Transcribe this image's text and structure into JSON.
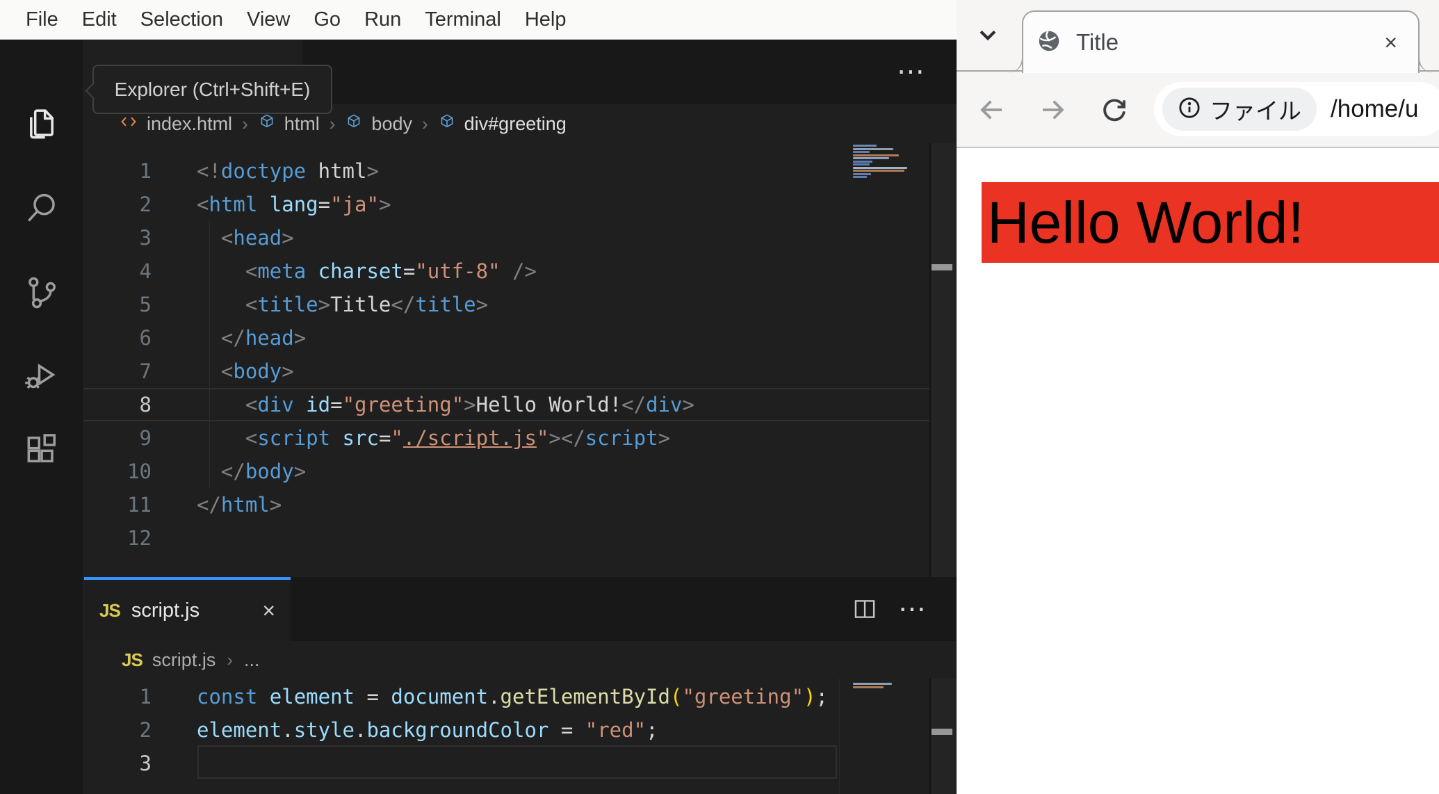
{
  "vscode": {
    "menubar": {
      "items": [
        "File",
        "Edit",
        "Selection",
        "View",
        "Go",
        "Run",
        "Terminal",
        "Help"
      ]
    },
    "activity_bar": {
      "tooltip": "Explorer (Ctrl+Shift+E)",
      "items": [
        {
          "id": "explorer",
          "icon": "files-icon",
          "active": true
        },
        {
          "id": "search",
          "icon": "search-icon",
          "active": false
        },
        {
          "id": "source-control",
          "icon": "source-control-icon",
          "active": false
        },
        {
          "id": "run-debug",
          "icon": "debug-icon",
          "active": false
        },
        {
          "id": "extensions",
          "icon": "extensions-icon",
          "active": false
        }
      ]
    },
    "editor_top": {
      "actions": {
        "more": "⋯"
      },
      "breadcrumb": {
        "file": "index.html",
        "sep": "›",
        "segments": [
          "html",
          "body",
          "div#greeting"
        ]
      },
      "active_line": 8,
      "lines": [
        [
          [
            "<!",
            "punct"
          ],
          [
            "doctype",
            "tag"
          ],
          [
            " html",
            "text"
          ],
          [
            ">",
            "punct"
          ]
        ],
        [
          [
            "<",
            "punct"
          ],
          [
            "html",
            "tag"
          ],
          [
            " ",
            "text"
          ],
          [
            "lang",
            "attr"
          ],
          [
            "=",
            "text"
          ],
          [
            "\"ja\"",
            "str"
          ],
          [
            ">",
            "punct"
          ]
        ],
        [
          [
            "  ",
            "text"
          ],
          [
            "<",
            "punct"
          ],
          [
            "head",
            "tag"
          ],
          [
            ">",
            "punct"
          ]
        ],
        [
          [
            "    ",
            "text"
          ],
          [
            "<",
            "punct"
          ],
          [
            "meta",
            "tag"
          ],
          [
            " ",
            "text"
          ],
          [
            "charset",
            "attr"
          ],
          [
            "=",
            "text"
          ],
          [
            "\"utf-8\"",
            "str"
          ],
          [
            " />",
            "punct"
          ]
        ],
        [
          [
            "    ",
            "text"
          ],
          [
            "<",
            "punct"
          ],
          [
            "title",
            "tag"
          ],
          [
            ">",
            "punct"
          ],
          [
            "Title",
            "text"
          ],
          [
            "</",
            "punct"
          ],
          [
            "title",
            "tag"
          ],
          [
            ">",
            "punct"
          ]
        ],
        [
          [
            "  ",
            "text"
          ],
          [
            "</",
            "punct"
          ],
          [
            "head",
            "tag"
          ],
          [
            ">",
            "punct"
          ]
        ],
        [
          [
            "  ",
            "text"
          ],
          [
            "<",
            "punct"
          ],
          [
            "body",
            "tag"
          ],
          [
            ">",
            "punct"
          ]
        ],
        [
          [
            "    ",
            "text"
          ],
          [
            "<",
            "punct"
          ],
          [
            "div",
            "tag"
          ],
          [
            " ",
            "text"
          ],
          [
            "id",
            "attr"
          ],
          [
            "=",
            "text"
          ],
          [
            "\"greeting\"",
            "str"
          ],
          [
            ">",
            "punct"
          ],
          [
            "Hello World!",
            "text"
          ],
          [
            "</",
            "punct"
          ],
          [
            "div",
            "tag"
          ],
          [
            ">",
            "punct"
          ]
        ],
        [
          [
            "    ",
            "text"
          ],
          [
            "<",
            "punct"
          ],
          [
            "script",
            "tag"
          ],
          [
            " ",
            "text"
          ],
          [
            "src",
            "attr"
          ],
          [
            "=",
            "text"
          ],
          [
            "\"",
            "str"
          ],
          [
            "./script.js",
            "strlink"
          ],
          [
            "\"",
            "str"
          ],
          [
            ">",
            "punct"
          ],
          [
            "</",
            "punct"
          ],
          [
            "script",
            "tag"
          ],
          [
            ">",
            "punct"
          ]
        ],
        [
          [
            "  ",
            "text"
          ],
          [
            "</",
            "punct"
          ],
          [
            "body",
            "tag"
          ],
          [
            ">",
            "punct"
          ]
        ],
        [
          [
            "</",
            "punct"
          ],
          [
            "html",
            "tag"
          ],
          [
            ">",
            "punct"
          ]
        ],
        []
      ],
      "minimap": [
        [
          34,
          "#6d88b3"
        ],
        [
          58,
          "#8f9db0"
        ],
        [
          24,
          "#5f7fb0"
        ],
        [
          66,
          "#b07a55"
        ],
        [
          52,
          "#8aa2c0"
        ],
        [
          28,
          "#5f7fb0"
        ],
        [
          24,
          "#5f7fb0"
        ],
        [
          78,
          "#a0b2c8"
        ],
        [
          74,
          "#b07a55"
        ],
        [
          26,
          "#5f7fb0"
        ],
        [
          20,
          "#5f7fb0"
        ]
      ]
    },
    "editor_bottom": {
      "tab": {
        "icon": "JS",
        "label": "script.js",
        "close": "×"
      },
      "actions": {
        "more": "⋯"
      },
      "breadcrumb": {
        "icon": "JS",
        "file": "script.js",
        "sep": "›",
        "more": "..."
      },
      "active_line": 3,
      "lines": [
        [
          [
            "const",
            "kw"
          ],
          [
            " ",
            "text"
          ],
          [
            "element",
            "var"
          ],
          [
            " = ",
            "text"
          ],
          [
            "document",
            "var"
          ],
          [
            ".",
            "text"
          ],
          [
            "getElementById",
            "fn"
          ],
          [
            "(",
            "paren"
          ],
          [
            "\"greeting\"",
            "str"
          ],
          [
            ")",
            "paren"
          ],
          [
            ";",
            "text"
          ]
        ],
        [
          [
            "element",
            "var"
          ],
          [
            ".",
            "text"
          ],
          [
            "style",
            "var"
          ],
          [
            ".",
            "text"
          ],
          [
            "backgroundColor",
            "var"
          ],
          [
            " = ",
            "text"
          ],
          [
            "\"red\"",
            "str"
          ],
          [
            ";",
            "text"
          ]
        ],
        []
      ],
      "minimap": [
        [
          56,
          "#8f9db0"
        ],
        [
          44,
          "#b07a55"
        ]
      ]
    }
  },
  "browser": {
    "tab": {
      "title": "Title",
      "close": "×"
    },
    "toolbar": {
      "chip": "ファイル",
      "url": "/home/u"
    },
    "page": {
      "heading": "Hello World!"
    }
  },
  "colors": {
    "accent_blue": "#3794ff",
    "banner_red": "#ea3323",
    "js_yellow": "#d9cb52",
    "editor_bg": "#1f1f1f",
    "panel_bg": "#181818"
  }
}
